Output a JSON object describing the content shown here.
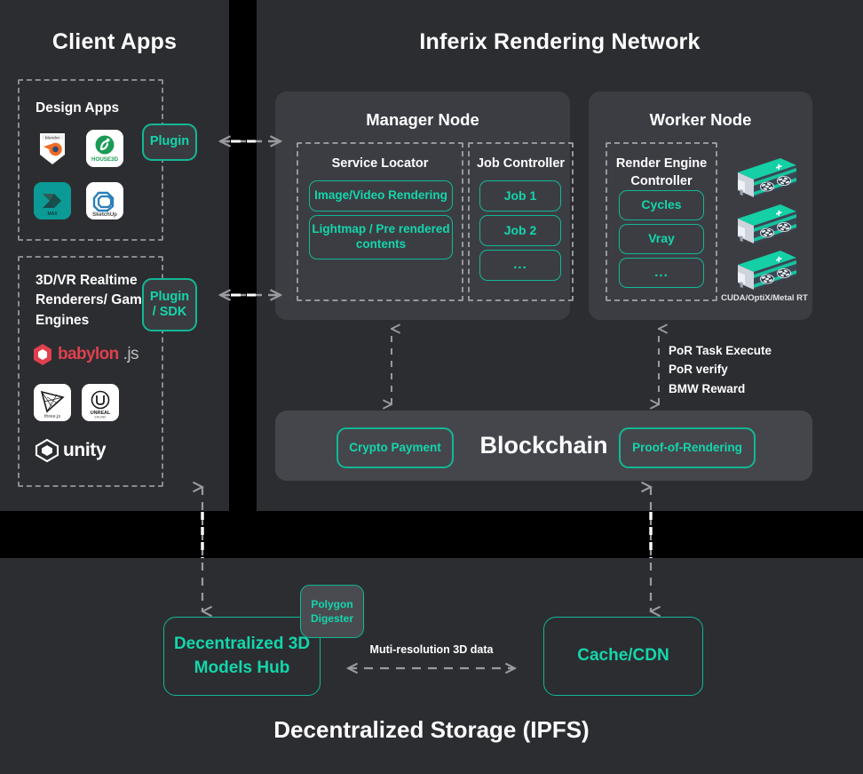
{
  "columns": {
    "client_apps_title": "Client Apps",
    "network_title": "Inferix Rendering Network",
    "storage_title": "Decentralized Storage (IPFS)"
  },
  "client_apps": {
    "design_apps": {
      "label": "Design Apps",
      "logos": [
        {
          "name": "blender-logo",
          "caption": "blender"
        },
        {
          "name": "house3d-logo",
          "caption": "HOUSE3D"
        },
        {
          "name": "3dsmax-logo",
          "caption": "MAX"
        },
        {
          "name": "sketchup-logo",
          "caption": "SketchUp"
        }
      ],
      "connector_label": "Plugin"
    },
    "realtime": {
      "label": "3D/VR Realtime Renderers/ Game Engines",
      "logos": [
        {
          "name": "babylonjs-logo",
          "caption": "babylon",
          "suffix": ".js"
        },
        {
          "name": "threejs-logo",
          "caption": "three.js"
        },
        {
          "name": "unreal-engine-logo",
          "caption": "UNREAL"
        },
        {
          "name": "unity-logo",
          "caption": "unity"
        }
      ],
      "connector_label_line1": "Plugin",
      "connector_label_line2": "/ SDK"
    }
  },
  "manager_node": {
    "title": "Manager Node",
    "service_locator": {
      "title": "Service Locator",
      "items": [
        {
          "label": "Image/Video Rendering"
        },
        {
          "label": "Lightmap / Pre rendered contents"
        }
      ]
    },
    "job_controller": {
      "title": "Job Controller",
      "items": [
        {
          "label": "Job 1"
        },
        {
          "label": "Job 2"
        },
        {
          "label": "..."
        }
      ]
    }
  },
  "worker_node": {
    "title": "Worker Node",
    "render_engine_controller": {
      "title": "Render Engine Controller",
      "items": [
        {
          "label": "Cycles"
        },
        {
          "label": "Vray"
        },
        {
          "label": "..."
        }
      ]
    },
    "gpu_caption": "CUDA/OptiX/Metal RT"
  },
  "blockchain": {
    "title": "Blockchain",
    "crypto_payment": "Crypto Payment",
    "proof_of_rendering": "Proof-of-Rendering",
    "por_notes": "PoR Task Execute\nPoR verify\nBMW Reward"
  },
  "storage": {
    "models_hub": "Decentralized 3D Models Hub",
    "cache_cdn": "Cache/CDN",
    "polygon_digester": "Polygon Digester",
    "multires_label": "Muti-resolution 3D data"
  },
  "colors": {
    "background": "#000000",
    "panel": "#2c2d31",
    "node_card": "#3c3d43",
    "blockchain_card": "#45464c",
    "teal_border": "#12b795",
    "teal_text": "#13d6ac",
    "white_text": "#ffffff",
    "dash_gray": "#8a8b90"
  }
}
